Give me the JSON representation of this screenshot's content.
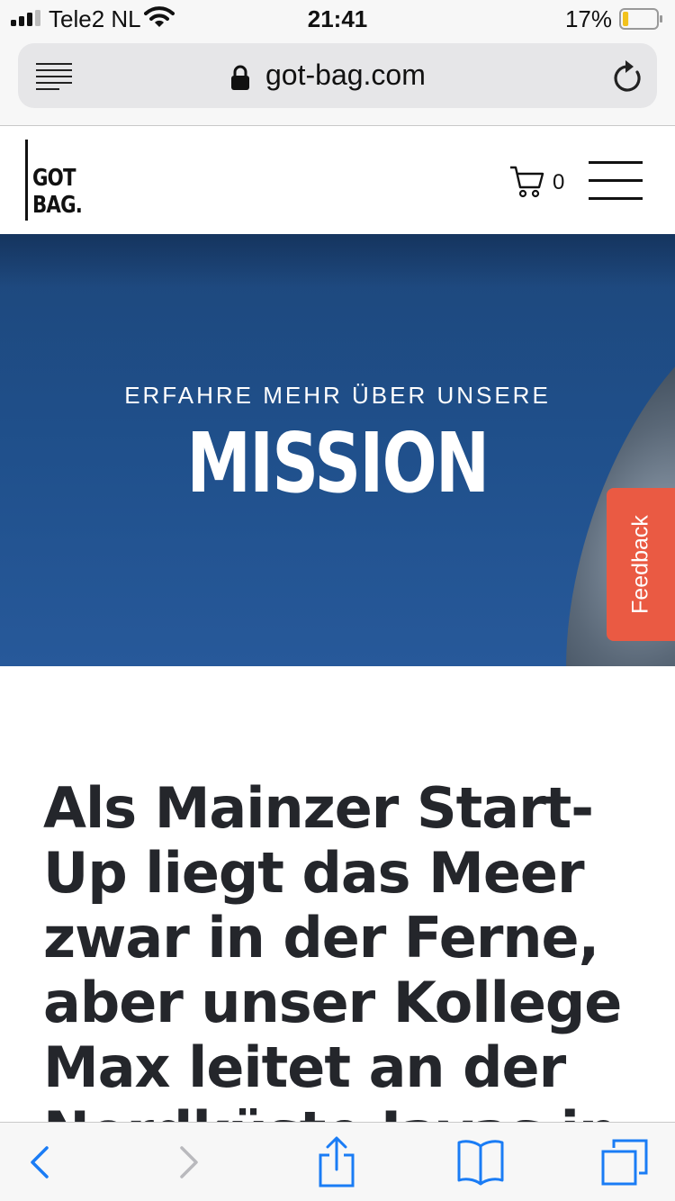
{
  "status_bar": {
    "carrier": "Tele2 NL",
    "time": "21:41",
    "battery_percent": "17%",
    "battery_level": 0.17,
    "signal_bars": 3,
    "icons": [
      "signal-icon",
      "wifi-icon",
      "battery-icon"
    ]
  },
  "browser": {
    "url": "got-bag.com",
    "icons": [
      "reader-icon",
      "lock-icon",
      "reload-icon"
    ]
  },
  "site_header": {
    "logo_text": "GOT\nBAG.",
    "cart_count": "0",
    "icons": [
      "cart-icon",
      "hamburger-menu-icon"
    ]
  },
  "hero": {
    "subtitle": "ERFAHRE MEHR ÜBER UNSERE",
    "title": "MISSION"
  },
  "feedback": {
    "label": "Feedback",
    "color": "#ea5a43"
  },
  "article": {
    "heading": "Als Mainzer Start-Up liegt das Meer zwar in der Ferne, aber unser Kollege Max leitet an der Nordküste Javas in"
  },
  "toolbar": {
    "icons": [
      "back-icon",
      "forward-icon",
      "share-icon",
      "bookmarks-icon",
      "tabs-icon"
    ],
    "accent": "#1a7cf5",
    "disabled": "#b9b9bd"
  }
}
